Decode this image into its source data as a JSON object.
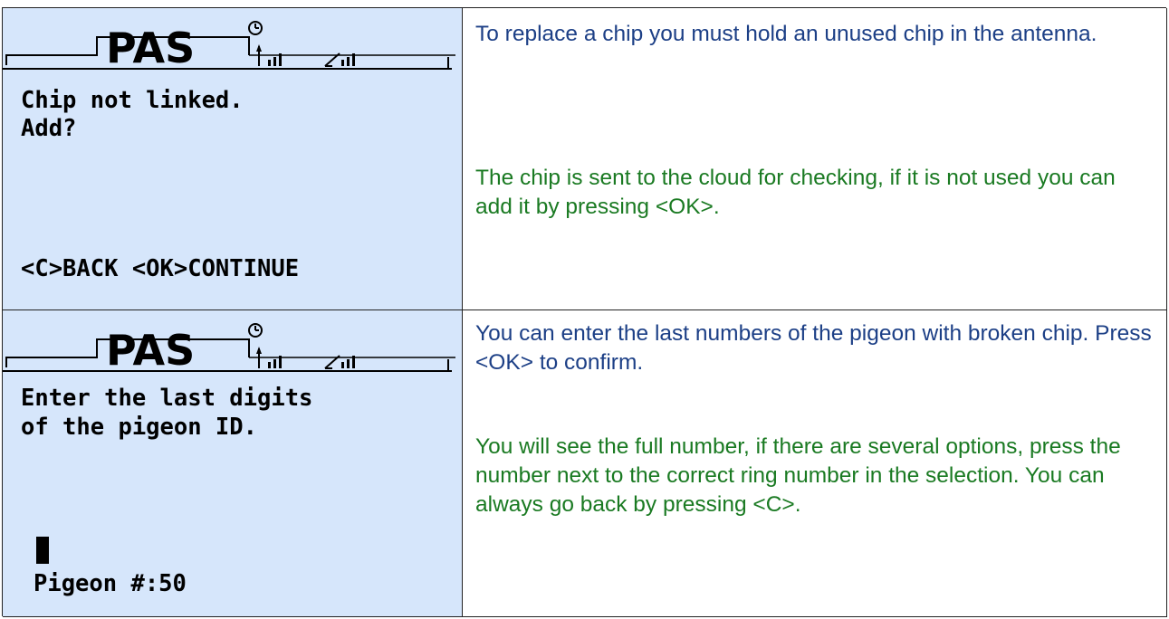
{
  "colors": {
    "screen_bg": "#d6e6fb",
    "blue_text": "#1c3f86",
    "green_text": "#1a7a22"
  },
  "rows": [
    {
      "screen": {
        "logo": "PAS",
        "line1": "Chip not linked.",
        "line2": "Add?",
        "footer": "<C>BACK <OK>CONTINUE"
      },
      "description": {
        "blue": "To replace a chip you must hold an unused chip in the antenna.",
        "green": "The chip is sent to the cloud for checking, if it is not used you can add it by pressing <OK>."
      }
    },
    {
      "screen": {
        "logo": "PAS",
        "line1": "Enter the last digits",
        "line2": "of the pigeon ID.",
        "footer": "Pigeon #:50"
      },
      "description": {
        "blue": "You can enter the last numbers of the pigeon with broken chip. Press <OK> to confirm.",
        "green": "You will see the full number, if there are several options, press the number next to the correct ring number in the selection. You can always go back by pressing <C>."
      }
    }
  ]
}
